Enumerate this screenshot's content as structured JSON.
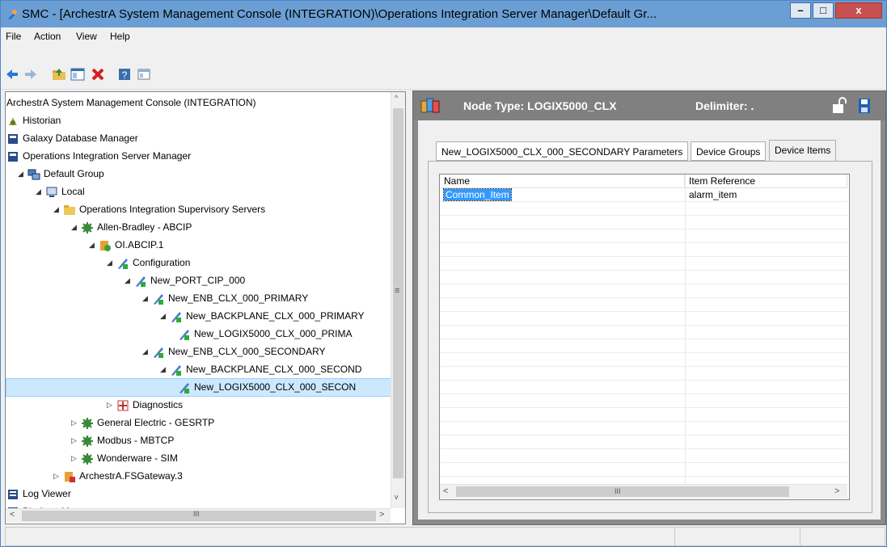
{
  "window": {
    "title": "SMC - [ArchestrA System Management Console (INTEGRATION)\\Operations Integration Server Manager\\Default Gr...",
    "minimize_label": "–",
    "maximize_label": "□",
    "close_label": "x"
  },
  "menu": [
    "File",
    "Action",
    "View",
    "Help"
  ],
  "tree": [
    {
      "label": "ArchestrA System Management Console (INTEGRATION)",
      "level": 0,
      "expander": "",
      "icon": "console-icon"
    },
    {
      "label": "Historian",
      "level": 0,
      "expander": "",
      "icon": "historian-icon"
    },
    {
      "label": "Galaxy Database Manager",
      "level": 0,
      "expander": "",
      "icon": "database-icon"
    },
    {
      "label": "Operations Integration Server Manager",
      "level": 0,
      "expander": "",
      "icon": "server-manager-icon"
    },
    {
      "label": "Default Group",
      "level": 1,
      "expander": "◢",
      "icon": "group-icon"
    },
    {
      "label": "Local",
      "level": 2,
      "expander": "◢",
      "icon": "computer-icon"
    },
    {
      "label": "Operations Integration Supervisory Servers",
      "level": 3,
      "expander": "◢",
      "icon": "folder-icon"
    },
    {
      "label": "Allen-Bradley - ABCIP",
      "level": 4,
      "expander": "◢",
      "icon": "gear-icon"
    },
    {
      "label": "OI.ABCIP.1",
      "level": 5,
      "expander": "◢",
      "icon": "server-icon"
    },
    {
      "label": "Configuration",
      "level": 6,
      "expander": "◢",
      "icon": "config-icon"
    },
    {
      "label": "New_PORT_CIP_000",
      "level": 7,
      "expander": "◢",
      "icon": "config-icon"
    },
    {
      "label": "New_ENB_CLX_000_PRIMARY",
      "level": 8,
      "expander": "◢",
      "icon": "config-icon"
    },
    {
      "label": "New_BACKPLANE_CLX_000_PRIMARY",
      "level": 9,
      "expander": "◢",
      "icon": "config-icon"
    },
    {
      "label": "New_LOGIX5000_CLX_000_PRIMA",
      "level": 10,
      "expander": "",
      "icon": "config-icon"
    },
    {
      "label": "New_ENB_CLX_000_SECONDARY",
      "level": 8,
      "expander": "◢",
      "icon": "config-icon"
    },
    {
      "label": "New_BACKPLANE_CLX_000_SECOND",
      "level": 9,
      "expander": "◢",
      "icon": "config-icon"
    },
    {
      "label": "New_LOGIX5000_CLX_000_SECON",
      "level": 10,
      "expander": "",
      "icon": "config-icon",
      "selected": true
    },
    {
      "label": "Diagnostics",
      "level": 6,
      "expander": "▷",
      "icon": "diagnostics-icon"
    },
    {
      "label": "General Electric - GESRTP",
      "level": 4,
      "expander": "▷",
      "icon": "gear-icon"
    },
    {
      "label": "Modbus - MBTCP",
      "level": 4,
      "expander": "▷",
      "icon": "gear-icon"
    },
    {
      "label": "Wonderware - SIM",
      "level": 4,
      "expander": "▷",
      "icon": "gear-icon"
    },
    {
      "label": "ArchestrA.FSGateway.3",
      "level": 3,
      "expander": "▷",
      "icon": "gateway-icon"
    },
    {
      "label": "Log Viewer",
      "level": 0,
      "expander": "",
      "icon": "log-icon"
    },
    {
      "label": "Platform Manager",
      "level": 0,
      "expander": "",
      "icon": "platform-icon"
    }
  ],
  "detail": {
    "node_type": "Node Type: LOGIX5000_CLX",
    "delimiter": "Delimiter: .",
    "tabs": [
      "New_LOGIX5000_CLX_000_SECONDARY Parameters",
      "Device Groups",
      "Device Items"
    ],
    "active_tab": "Device Items",
    "grid": {
      "columns": [
        "Name",
        "Item Reference"
      ],
      "rows": [
        [
          "Common_Item",
          "alarm_item"
        ]
      ]
    }
  },
  "scroll_grip": "III"
}
